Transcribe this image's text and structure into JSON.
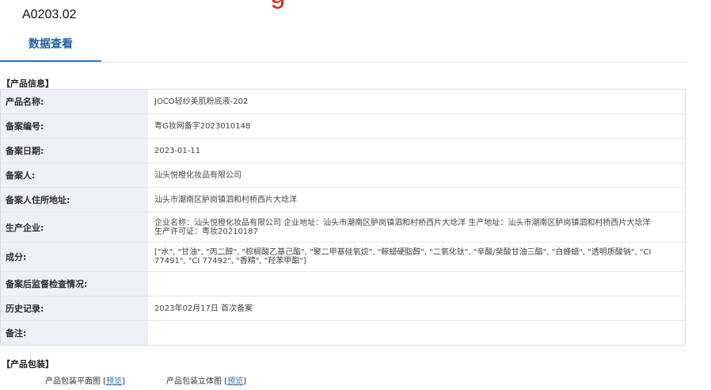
{
  "header": {
    "code": "A0203.02",
    "red_title_partial": "  -    -  g"
  },
  "tabs": [
    {
      "label": "数据查看",
      "active": true
    }
  ],
  "product_info": {
    "section_title": "【产品信息】",
    "rows": [
      {
        "label": "产品名称:",
        "value": "JOCO轻纱美肌粉底液-202"
      },
      {
        "label": "备案编号:",
        "value": "粤G妆网备字2023010148"
      },
      {
        "label": "备案日期:",
        "value": "2023-01-11"
      },
      {
        "label": "备案人:",
        "value": "汕头悦橙化妆品有限公司"
      },
      {
        "label": "备案人住所地址:",
        "value": "汕头市潮南区胪岗镇泗和村桥西片大埝洋"
      },
      {
        "label": "生产企业:",
        "value": "企业名称：汕头悦橙化妆品有限公司 企业地址：汕头市潮南区胪岗镇泗和村桥西片大埝洋 生产地址：汕头市潮南区胪岗镇泗和村桥西片大埝洋 生产许可证：粤妆20210187"
      },
      {
        "label": "成分:",
        "value": "[\"水\", \"甘油\", \"丙二醇\", \"棕榈酸乙基己酯\", \"聚二甲基硅氧烷\", \"鲸蜡硬脂醇\", \"二氧化钛\", \"辛酸/癸酸甘油三酯\", \"白蜂蜡\", \"透明质酸钠\", \"CI 77491\", \"CI 77492\", \"香精\", \"羟苯甲酯\"]"
      },
      {
        "label": "备案后监督检查情况:",
        "value": ""
      },
      {
        "label": "历史记录:",
        "value": "2023年02月17日 首次备案"
      },
      {
        "label": "备注:",
        "value": ""
      }
    ]
  },
  "packaging": {
    "section_title": "【产品包装】",
    "items": [
      {
        "label": "产品包装平面图",
        "link": "预览"
      },
      {
        "label": "产品包装立体图",
        "link": "预览"
      }
    ]
  },
  "colors": {
    "accent": "#2a7ac0",
    "label_bg": "#edf0f4",
    "link": "#2a6fb8",
    "red": "#e8201c"
  }
}
